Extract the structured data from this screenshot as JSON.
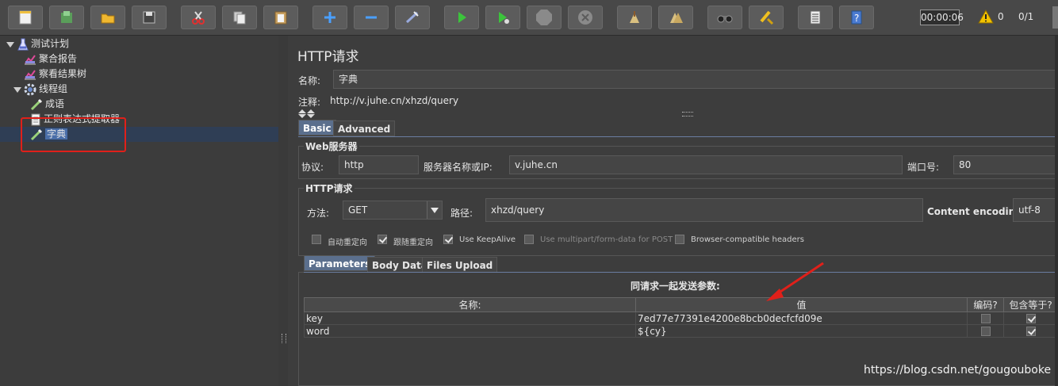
{
  "toolbar": {
    "buttons": [
      "new",
      "templates",
      "open",
      "save",
      "cut",
      "copy",
      "paste",
      "expand",
      "collapse",
      "toggle",
      "start",
      "start-no-pauses",
      "stop",
      "shutdown",
      "clear",
      "clear-all",
      "search",
      "reset-search",
      "function-helper",
      "help"
    ],
    "elapsed_time": "00:00:06",
    "error_count": "0",
    "thread_count": "0/1"
  },
  "tree": {
    "items": [
      {
        "label": "测试计划",
        "icon": "flask-icon",
        "level": 0
      },
      {
        "label": "聚合报告",
        "icon": "chart-icon",
        "level": 1
      },
      {
        "label": "察看结果树",
        "icon": "chart-icon",
        "level": 1
      },
      {
        "label": "线程组",
        "icon": "gear-icon",
        "level": 0
      },
      {
        "label": "成语",
        "icon": "pipette-icon",
        "level": 1
      },
      {
        "label": "正则表达式提取器",
        "icon": "document-icon",
        "level": 2
      },
      {
        "label": "字典",
        "icon": "pipette-icon",
        "level": 1,
        "selected": true
      }
    ]
  },
  "panel": {
    "title": "HTTP请求",
    "name_label": "名称:",
    "name_value": "字典",
    "comment_label": "注释:",
    "comment_value": "http://v.juhe.cn/xhzd/query",
    "tabs": [
      "Basic",
      "Advanced"
    ],
    "web_server": {
      "title": "Web服务器",
      "protocol_label": "协议:",
      "protocol_value": "http",
      "server_label": "服务器名称或IP:",
      "server_value": "v.juhe.cn",
      "port_label": "端口号:",
      "port_value": "80"
    },
    "http_request": {
      "title": "HTTP请求",
      "method_label": "方法:",
      "method_value": "GET",
      "path_label": "路径:",
      "path_value": "xhzd/query",
      "encoding_label": "Content encoding:",
      "encoding_value": "utf-8"
    },
    "options": [
      {
        "label": "自动重定向",
        "checked": false
      },
      {
        "label": "跟随重定向",
        "checked": true
      },
      {
        "label": "Use KeepAlive",
        "checked": true
      },
      {
        "label": "Use multipart/form-data for POST",
        "checked": false
      },
      {
        "label": "Browser-compatible headers",
        "checked": false
      }
    ],
    "sub_tabs": [
      "Parameters",
      "Body Data",
      "Files Upload"
    ],
    "params_caption": "同请求一起发送参数:",
    "params_headers": [
      "名称:",
      "值",
      "编码?",
      "包含等于?"
    ],
    "params_rows": [
      {
        "name": "key",
        "value": "7ed77e77391e4200e8bcb0decfcfd09e",
        "encode": false,
        "include_equals": true
      },
      {
        "name": "word",
        "value": "${cy}",
        "encode": false,
        "include_equals": true
      }
    ]
  },
  "watermark": "https://blog.csdn.net/gougouboke",
  "colors": {
    "highlight": "#e0201a",
    "selection": "#4a6ea8"
  }
}
